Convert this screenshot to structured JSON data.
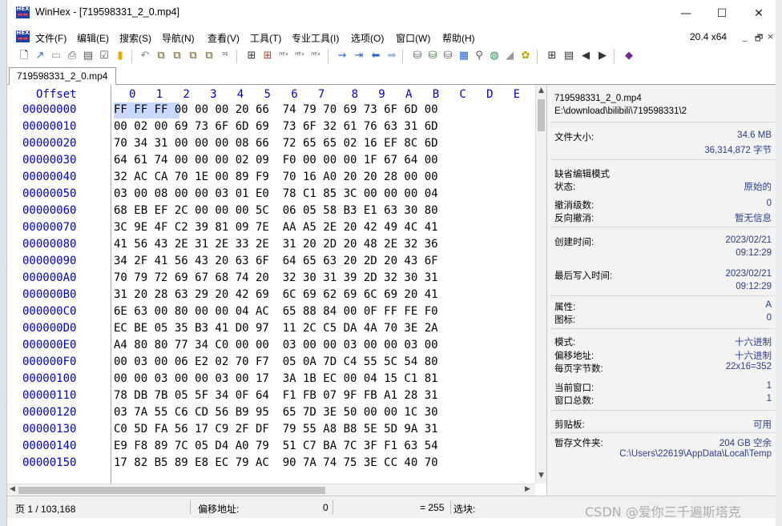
{
  "window": {
    "title": "WinHex - [719598331_2_0.mp4]",
    "icon_label": "HEX",
    "controls": [
      "—",
      "☐",
      "✕"
    ]
  },
  "menu": {
    "items": [
      "文件(F)",
      "编辑(E)",
      "搜索(S)",
      "导航(N)",
      "查看(V)",
      "工具(T)",
      "专业工具(I)",
      "选项(O)",
      "窗口(W)",
      "帮助(H)"
    ],
    "zoom": "20.4 x64",
    "mdi_controls": [
      "_",
      "🗗",
      "×"
    ]
  },
  "toolbar": {
    "icons": [
      "new-file-icon",
      "open-icon",
      "save-icon",
      "print-icon",
      "properties-icon",
      "undo-icon",
      "copy-icon",
      "paste-icon",
      "find-icon",
      "replace-icon",
      "goto-icon",
      "back-icon",
      "forward-icon",
      "disk-icon",
      "ram-icon",
      "calc-icon",
      "settings-icon"
    ]
  },
  "tab": {
    "label": "719598331_2_0.mp4"
  },
  "hex_view": {
    "header_offset": "Offset",
    "header_cols": [
      "0",
      "1",
      "2",
      "3",
      "4",
      "5",
      "6",
      "7",
      "8",
      "9",
      "A",
      "B",
      "C",
      "D",
      "E"
    ],
    "rows": [
      {
        "offset": "00000000",
        "bytes": "FF FF FF 00 00 00 20 66  74 79 70 69 73 6F 6D 00"
      },
      {
        "offset": "00000010",
        "bytes": "00 02 00 69 73 6F 6D 69  73 6F 32 61 76 63 31 6D"
      },
      {
        "offset": "00000020",
        "bytes": "70 34 31 00 00 00 08 66  72 65 65 02 16 EF 8C 6D"
      },
      {
        "offset": "00000030",
        "bytes": "64 61 74 00 00 00 02 09  F0 00 00 00 1F 67 64 00"
      },
      {
        "offset": "00000040",
        "bytes": "32 AC CA 70 1E 00 89 F9  70 16 A0 20 20 28 00 00"
      },
      {
        "offset": "00000050",
        "bytes": "03 00 08 00 00 03 01 E0  78 C1 85 3C 00 00 00 04"
      },
      {
        "offset": "00000060",
        "bytes": "68 EB EF 2C 00 00 00 5C  06 05 58 B3 E1 63 30 80"
      },
      {
        "offset": "00000070",
        "bytes": "3C 9E 4F C2 39 81 09 7E  AA A5 2E 20 42 49 4C 41"
      },
      {
        "offset": "00000080",
        "bytes": "41 56 43 2E 31 2E 33 2E  31 20 2D 20 48 2E 32 36"
      },
      {
        "offset": "00000090",
        "bytes": "34 2F 41 56 43 20 63 6F  64 65 63 20 2D 20 43 6F"
      },
      {
        "offset": "000000A0",
        "bytes": "70 79 72 69 67 68 74 20  32 30 31 39 2D 32 30 31"
      },
      {
        "offset": "000000B0",
        "bytes": "31 20 28 63 29 20 42 69  6C 69 62 69 6C 69 20 41"
      },
      {
        "offset": "000000C0",
        "bytes": "6E 63 00 80 00 00 04 AC  65 88 84 00 0F FF FE F0"
      },
      {
        "offset": "000000D0",
        "bytes": "EC BE 05 35 B3 41 D0 97  11 2C C5 DA 4A 70 3E 2A"
      },
      {
        "offset": "000000E0",
        "bytes": "A4 80 80 77 34 C0 00 00  03 00 00 03 00 00 03 00"
      },
      {
        "offset": "000000F0",
        "bytes": "00 03 00 06 E2 02 70 F7  05 0A 7D C4 55 5C 54 80"
      },
      {
        "offset": "00000100",
        "bytes": "00 00 03 00 00 03 00 17  3A 1B EC 00 04 15 C1 81"
      },
      {
        "offset": "00000110",
        "bytes": "78 DB 7B 05 5F 34 0F 64  F1 FB 07 9F FB A1 28 31"
      },
      {
        "offset": "00000120",
        "bytes": "03 7A 55 C6 CD 56 B9 95  65 7D 3E 50 00 00 1C 30"
      },
      {
        "offset": "00000130",
        "bytes": "C0 5D FA 56 17 C9 2F DF  79 55 A8 B8 5E 5D 9A 31"
      },
      {
        "offset": "00000140",
        "bytes": "E9 F8 89 7C 05 D4 A0 79  51 C7 BA 7C 3F F1 63 54"
      },
      {
        "offset": "00000150",
        "bytes": "17 82 B5 89 E8 EC 79 AC  90 7A 74 75 3E CC 40 70"
      }
    ]
  },
  "info_panel": {
    "filename": "719598331_2_0.mp4",
    "path": "E:\\download\\bilibili\\719598331\\2",
    "file_size_label": "文件大小:",
    "file_size_mb": "34.6 MB",
    "file_size_bytes": "36,314,872 字节",
    "default_edit_mode": "缺省编辑模式",
    "state_label": "状态:",
    "state_value": "原始的",
    "undo_level_label": "撤消级数:",
    "undo_level_value": "0",
    "reverse_undo_label": "反向撤消:",
    "reverse_undo_value": "暂无信息",
    "created_label": "创建时间:",
    "created_date": "2023/02/21",
    "created_time": "09:12:29",
    "last_write_label": "最后写入时间:",
    "last_write_date": "2023/02/21",
    "last_write_time": "09:12:29",
    "attributes_label": "属性:",
    "attributes_value": "A",
    "icons_label": "图标:",
    "icons_value": "0",
    "mode_label": "模式:",
    "mode_value": "十六进制",
    "offset_label": "偏移地址:",
    "offset_value": "十六进制",
    "bytes_per_page_label": "每页字节数:",
    "bytes_per_page_value": "22x16=352",
    "current_window_label": "当前窗口:",
    "current_window_value": "1",
    "window_total_label": "窗口总数:",
    "window_total_value": "1",
    "clipboard_label": "剪贴板:",
    "clipboard_value": "可用",
    "temp_folder_label": "暂存文件夹:",
    "temp_folder_free": "204 GB 空余",
    "temp_folder_path": "C:\\Users\\22619\\AppData\\Local\\Temp"
  },
  "status": {
    "page": "页 1 / 103,168",
    "offset_label": "偏移地址:",
    "offset_value": "0",
    "value": "= 255",
    "selection_label": "选块:",
    "watermark": "CSDN @爱你三千遍斯塔克"
  }
}
